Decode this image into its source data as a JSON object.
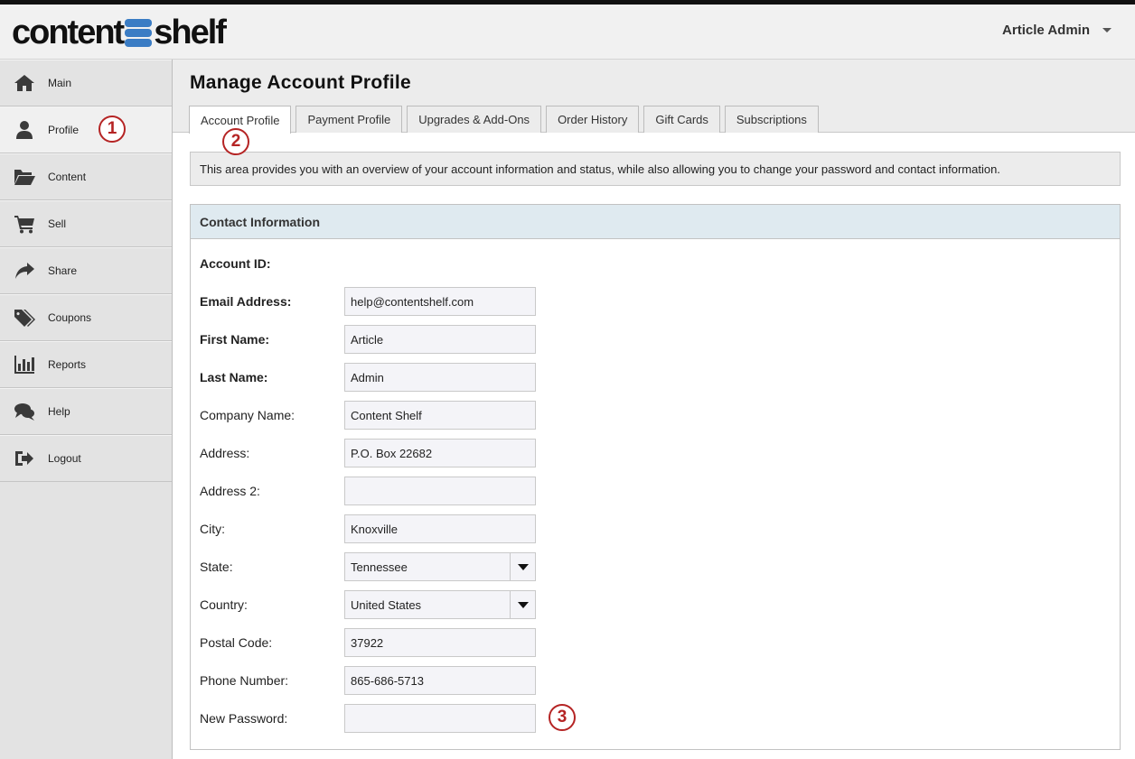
{
  "header": {
    "logo_left": "content",
    "logo_right": "shelf",
    "user_name": "Article Admin"
  },
  "sidebar": {
    "items": [
      {
        "label": "Main",
        "icon": "home-icon"
      },
      {
        "label": "Profile",
        "icon": "user-icon"
      },
      {
        "label": "Content",
        "icon": "folder-icon"
      },
      {
        "label": "Sell",
        "icon": "cart-icon"
      },
      {
        "label": "Share",
        "icon": "share-icon"
      },
      {
        "label": "Coupons",
        "icon": "tags-icon"
      },
      {
        "label": "Reports",
        "icon": "bar-chart-icon"
      },
      {
        "label": "Help",
        "icon": "chat-icon"
      },
      {
        "label": "Logout",
        "icon": "logout-icon"
      }
    ],
    "active": "Profile"
  },
  "callouts": {
    "one": "1",
    "two": "2",
    "three": "3"
  },
  "main": {
    "title": "Manage Account Profile",
    "tabs": [
      {
        "label": "Account Profile"
      },
      {
        "label": "Payment Profile"
      },
      {
        "label": "Upgrades & Add-Ons"
      },
      {
        "label": "Order History"
      },
      {
        "label": "Gift Cards"
      },
      {
        "label": "Subscriptions"
      }
    ],
    "active_tab": "Account Profile",
    "info": "This area provides you with an overview of your account information and status, while also allowing you to change your password and contact information."
  },
  "contact": {
    "heading": "Contact Information",
    "account_id_label": "Account ID:",
    "account_id_value": "",
    "email_label": "Email Address:",
    "email_value": "help@contentshelf.com",
    "first_name_label": "First Name:",
    "first_name_value": "Article",
    "last_name_label": "Last Name:",
    "last_name_value": "Admin",
    "company_label": "Company Name:",
    "company_value": "Content Shelf",
    "address_label": "Address:",
    "address_value": "P.O. Box 22682",
    "address2_label": "Address 2:",
    "address2_value": "",
    "city_label": "City:",
    "city_value": "Knoxville",
    "state_label": "State:",
    "state_value": "Tennessee",
    "country_label": "Country:",
    "country_value": "United States",
    "postal_label": "Postal Code:",
    "postal_value": "37922",
    "phone_label": "Phone Number:",
    "phone_value": "865-686-5713",
    "password_label": "New Password:",
    "password_value": ""
  },
  "colors": {
    "logo_accent": "#3a7cc4",
    "callout": "#b52424",
    "panel_header": "#dfeaf0"
  }
}
